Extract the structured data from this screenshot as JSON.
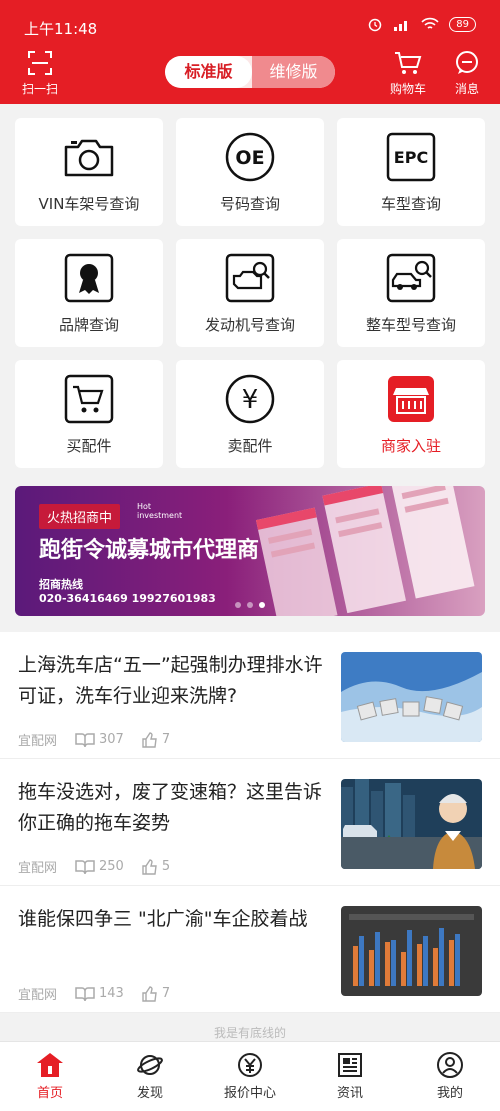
{
  "status": {
    "time": "上午11:48",
    "battery": "89"
  },
  "header": {
    "scan_label": "扫一扫",
    "cart_label": "购物车",
    "msg_label": "消息",
    "toggle_on": "标准版",
    "toggle_off": "维修版"
  },
  "grid": [
    {
      "label": "VIN车架号查询",
      "icon": "camera-icon"
    },
    {
      "label": "号码查询",
      "icon": "oe-icon",
      "icon_text": "OE"
    },
    {
      "label": "车型查询",
      "icon": "epc-icon",
      "icon_text": "EPC"
    },
    {
      "label": "品牌查询",
      "icon": "brand-badge-icon"
    },
    {
      "label": "发动机号查询",
      "icon": "engine-search-icon"
    },
    {
      "label": "整车型号查询",
      "icon": "car-search-icon"
    },
    {
      "label": "买配件",
      "icon": "cart-icon"
    },
    {
      "label": "卖配件",
      "icon": "yen-icon",
      "icon_text": "¥"
    },
    {
      "label": "商家入驻",
      "icon": "shop-icon",
      "accent": "#e51e25"
    }
  ],
  "banner": {
    "tag": "火热招商中",
    "tag_en_1": "Hot",
    "tag_en_2": "investment",
    "title": "跑街令诚募城市代理商",
    "hotline_label": "招商热线",
    "phones": "020-36416469  19927601983"
  },
  "news": [
    {
      "title": "上海洗车店“五一”起强制办理排水许可证，洗车行业迎来洗牌?",
      "source": "宜配网",
      "reads": "307",
      "likes": "7"
    },
    {
      "title": "拖车没选对，废了变速箱？这里告诉你正确的拖车姿势",
      "source": "宜配网",
      "reads": "250",
      "likes": "5"
    },
    {
      "title": "谁能保四争三 \"北广渝\"车企胶着战",
      "source": "宜配网",
      "reads": "143",
      "likes": "7"
    }
  ],
  "peek_text": "我是有底线的",
  "tabs": [
    {
      "label": "首页",
      "icon": "home-icon",
      "active": true
    },
    {
      "label": "发现",
      "icon": "planet-icon"
    },
    {
      "label": "报价中心",
      "icon": "price-icon"
    },
    {
      "label": "资讯",
      "icon": "news-icon"
    },
    {
      "label": "我的",
      "icon": "user-icon"
    }
  ],
  "colors": {
    "brand": "#e51e25"
  }
}
